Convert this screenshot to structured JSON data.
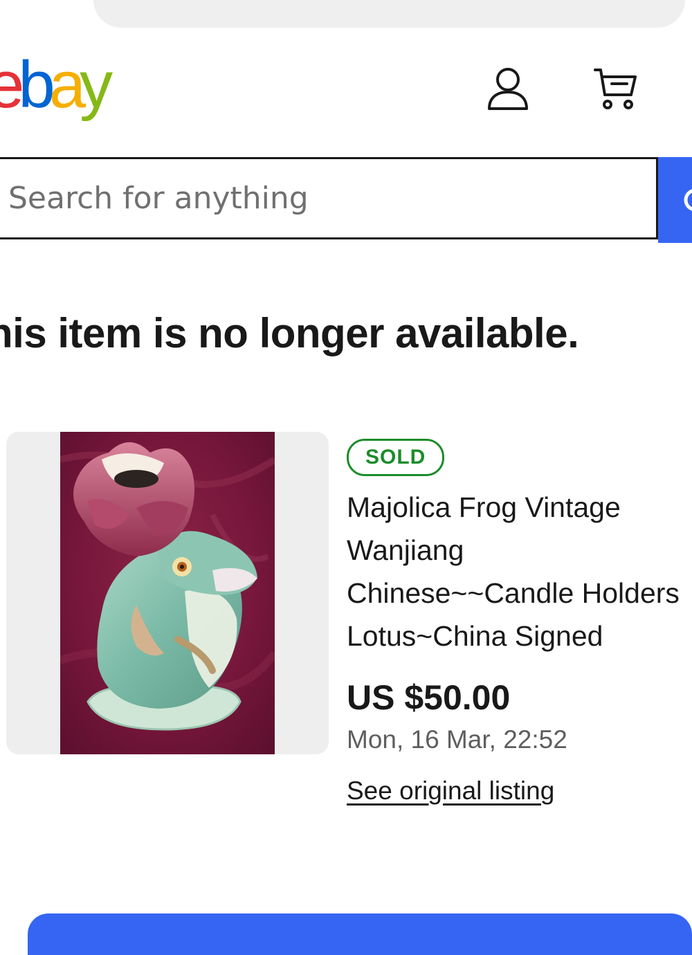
{
  "header": {
    "logo": {
      "letters": [
        {
          "char": "e",
          "color": "#e53238"
        },
        {
          "char": "b",
          "color": "#0064d2"
        },
        {
          "char": "a",
          "color": "#f5af02"
        },
        {
          "char": "y",
          "color": "#86b817"
        }
      ],
      "alt": "ebay"
    },
    "icons": [
      "account-icon",
      "cart-icon"
    ]
  },
  "search": {
    "placeholder": "Search for anything",
    "value": "",
    "button_color": "#3665f3"
  },
  "notice": {
    "text": "his item is no longer available."
  },
  "item": {
    "status": "SOLD",
    "status_color": "#1c8c2a",
    "title": "Majolica Frog Vintage Wanjiang Chinese~~Candle Holders Lotus~China Signed",
    "price": "US $50.00",
    "sold_date": "Mon, 16 Mar, 22:52",
    "link_label": "See original listing",
    "image_description": "frog holding lotus candle holder"
  },
  "colors": {
    "text_primary": "#191919",
    "text_secondary": "#5e5e5e",
    "accent_blue": "#3665f3",
    "card_bg": "#eeeeee"
  }
}
